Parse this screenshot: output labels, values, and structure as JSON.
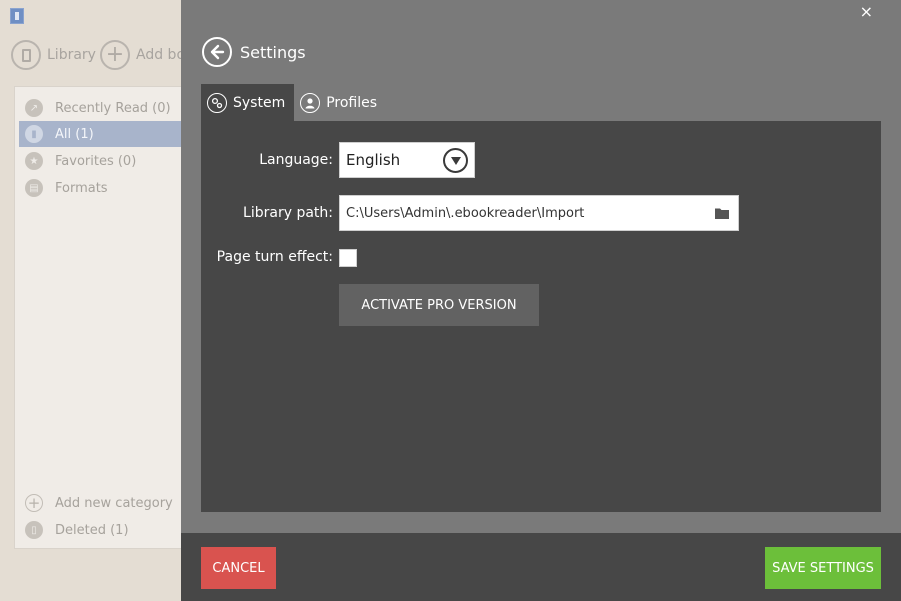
{
  "background_app": {
    "toolbar": {
      "library_label": "Library",
      "add_book_label": "Add bo"
    },
    "sidebar": {
      "items": [
        {
          "label": "Recently Read (0)",
          "icon": "share-icon"
        },
        {
          "label": "All (1)",
          "icon": "book-icon",
          "active": true
        },
        {
          "label": "Favorites (0)",
          "icon": "star-icon"
        },
        {
          "label": "Formats",
          "icon": "file-icon"
        }
      ],
      "bottom_items": [
        {
          "label": "Add new category",
          "icon": "plus-icon"
        },
        {
          "label": "Deleted (1)",
          "icon": "trash-icon"
        }
      ]
    }
  },
  "settings": {
    "close_glyph": "×",
    "title": "Settings",
    "tabs": [
      {
        "label": "System",
        "icon": "gears-icon",
        "active": true
      },
      {
        "label": "Profiles",
        "icon": "user-icon",
        "active": false
      }
    ],
    "language": {
      "label": "Language:",
      "value": "English"
    },
    "library_path": {
      "label": "Library path:",
      "value": "C:\\Users\\Admin\\.ebookreader\\Import"
    },
    "page_turn": {
      "label": "Page turn effect:",
      "checked": false
    },
    "activate_pro_label": "ACTIVATE PRO VERSION",
    "cancel_label": "CANCEL",
    "save_label": "SAVE SETTINGS"
  },
  "colors": {
    "overlay": "#7a7a7a",
    "panel": "#474747",
    "cancel": "#d9534f",
    "save": "#6cbf3a",
    "sidebar_active": "#a8b4cb"
  }
}
